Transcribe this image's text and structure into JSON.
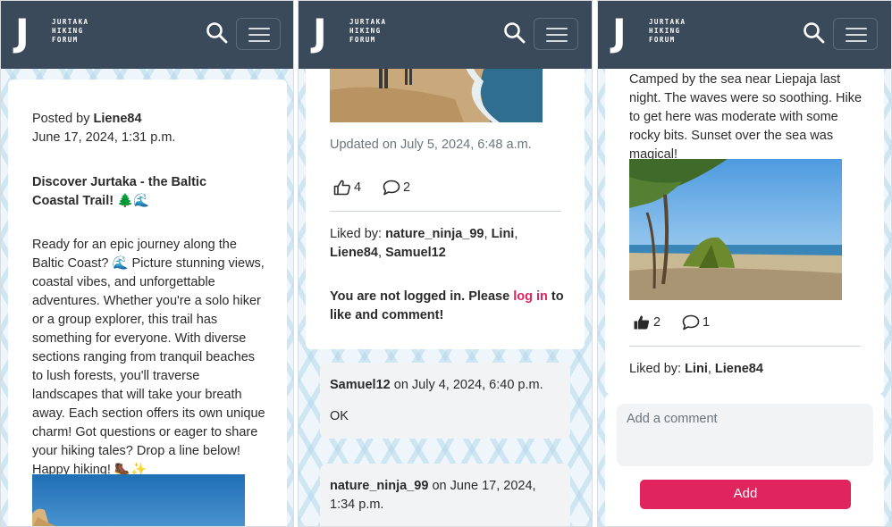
{
  "brand": {
    "letter": "J",
    "lines": [
      "JURTAKA",
      "HIKING",
      "FORUM"
    ]
  },
  "panel1": {
    "posted_by_label": "Posted by",
    "author": "Liene84",
    "date": "June 17, 2024, 1:31 p.m.",
    "title": "Discover Jurtaka - the Baltic Coastal Trail! 🌲🌊",
    "body": "Ready for an epic journey along the Baltic Coast? 🌊 Picture stunning views, coastal vibes, and unforgettable adventures. Whether you're a solo hiker or a group explorer, this trail has something for everyone. With diverse sections ranging from tranquil beaches to lush forests, you'll traverse landscapes that will take your breath away. Each section offers its own unique charm! Got questions or eager to share your hiking tales? Drop a line below! Happy hiking! 🥾✨"
  },
  "panel2": {
    "updated": "Updated on July 5, 2024, 6:48 a.m.",
    "likes_count": "4",
    "comments_count": "2",
    "liked_by_label": "Liked by:",
    "liked_by_names": [
      "nature_ninja_99",
      "Lini",
      "Liene84",
      "Samuel12"
    ],
    "not_logged_in": "You are not logged in. Please",
    "login_link": "log in",
    "not_logged_in_suffix": "to like and comment!",
    "comments": [
      {
        "author": "Samuel12",
        "on": "on July 4, 2024, 6:40 p.m.",
        "text": "OK"
      },
      {
        "author": "nature_ninja_99",
        "on": "on June 17, 2024, 1:34 p.m.",
        "text": ""
      }
    ]
  },
  "panel3": {
    "body": "Camped by the sea near Liepaja last night. The waves were so soothing. Hike to get here was moderate with some rocky bits. Sunset over the sea was magical!",
    "likes_count": "2",
    "comments_count": "1",
    "liked_by_label": "Liked by:",
    "liked_by_names": [
      "Lini",
      "Liene84"
    ],
    "comment_placeholder": "Add a comment",
    "add_button": "Add"
  },
  "colors": {
    "navbar": "#3a4a5a",
    "accent": "#e0245e",
    "page_bg": "#eef6fb"
  },
  "icons": [
    "search-icon",
    "menu-icon",
    "thumbs-up-icon",
    "comment-icon",
    "thumbs-up-filled-icon"
  ]
}
